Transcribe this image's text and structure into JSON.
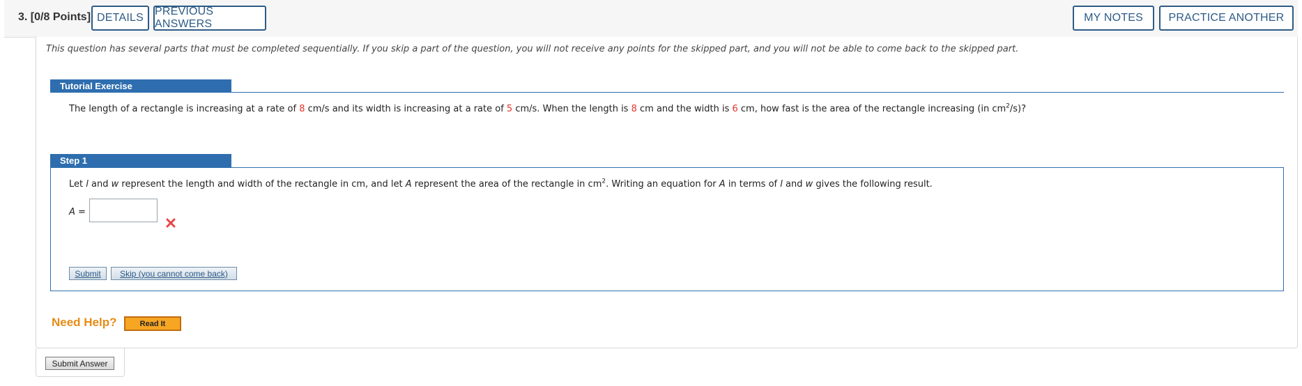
{
  "header": {
    "question_number": "3.",
    "points": "[0/8 Points]",
    "buttons": {
      "details": "DETAILS",
      "previous_answers": "PREVIOUS ANSWERS",
      "my_notes": "MY NOTES",
      "practice_another": "PRACTICE ANOTHER"
    }
  },
  "notice": "This question has several parts that must be completed sequentially. If you skip a part of the question, you will not receive any points for the skipped part, and you will not be able to come back to the skipped part.",
  "tutorial": {
    "heading": "Tutorial Exercise",
    "problem": {
      "p1": "The length of a rectangle is increasing at a rate of ",
      "rate_length": "8",
      "p2": " cm/s and its width is increasing at a rate of ",
      "rate_width": "5",
      "p3": " cm/s. When the length is ",
      "length": "8",
      "p4": " cm and the width is ",
      "width": "6",
      "p5": " cm, how fast is the area of the rectangle increasing (in cm",
      "sup": "2",
      "p6": "/s)?"
    }
  },
  "step1": {
    "heading": "Step 1",
    "text": {
      "p1": "Let ",
      "l": "l",
      "p2": " and ",
      "w": "w",
      "p3": " represent the length and width of the rectangle in cm, and let ",
      "A": "A",
      "p4": " represent the area of the rectangle in cm",
      "sup": "2",
      "p5": ". Writing an equation for ",
      "A2": "A",
      "p6": " in terms of ",
      "l2": "l",
      "p7": " and ",
      "w2": "w",
      "p8": " gives the following result."
    },
    "answer_label_var": "A",
    "answer_label_eq": " =",
    "answer_value": "",
    "submit_label": "Submit",
    "skip_label": "Skip (you cannot come back)"
  },
  "help": {
    "label": "Need Help?",
    "read_it": "Read It"
  },
  "submit_answer_label": "Submit Answer",
  "colors": {
    "accent": "#2e6eaf",
    "button_text": "#2d5b86",
    "highlight_number": "#e8332a",
    "help": "#e58c17",
    "wrong": "#e84545"
  }
}
